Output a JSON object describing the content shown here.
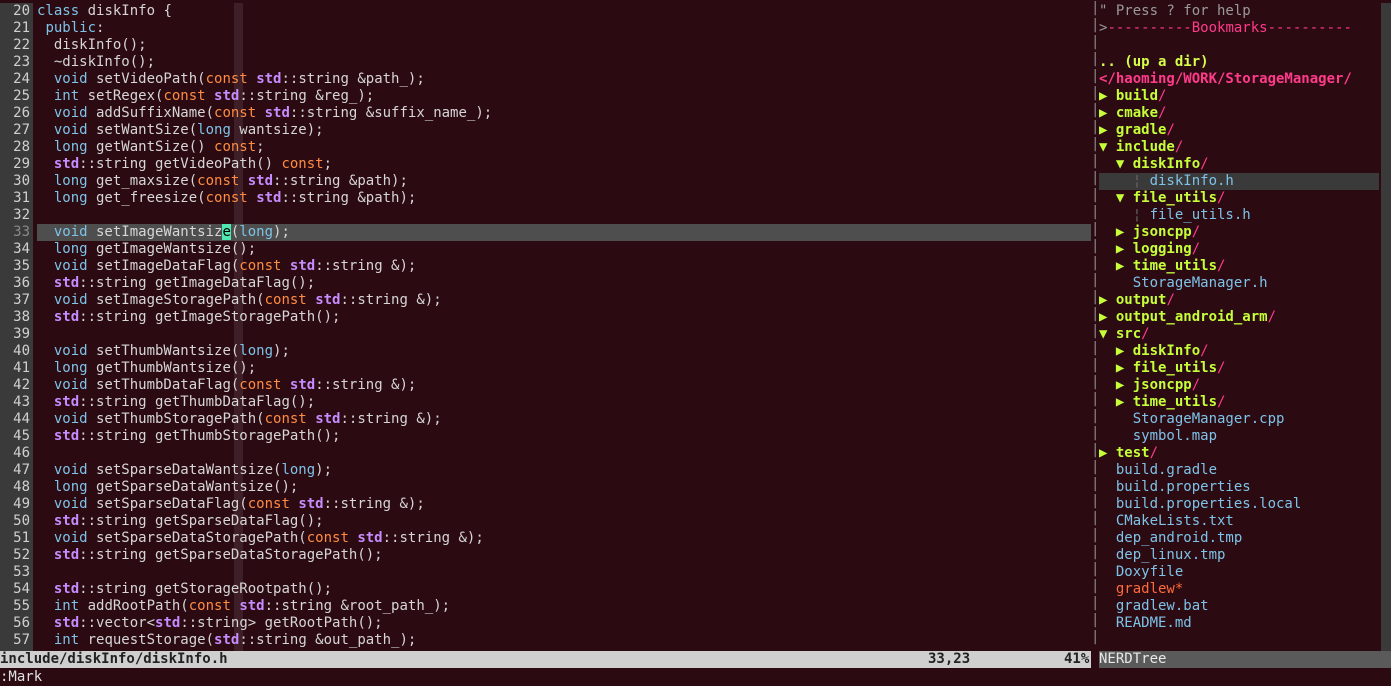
{
  "editor": {
    "lines": [
      {
        "n": "20",
        "code": [
          [
            "kw",
            "class"
          ],
          [
            "tx",
            " diskInfo {"
          ]
        ]
      },
      {
        "n": "21",
        "code": [
          [
            "tx",
            " "
          ],
          [
            "kw",
            "public"
          ],
          [
            "tx",
            ":"
          ]
        ]
      },
      {
        "n": "22",
        "code": [
          [
            "tx",
            "  diskInfo();"
          ]
        ]
      },
      {
        "n": "23",
        "code": [
          [
            "tx",
            "  ~diskInfo();"
          ]
        ]
      },
      {
        "n": "24",
        "code": [
          [
            "tx",
            "  "
          ],
          [
            "ty",
            "void"
          ],
          [
            "tx",
            " setVideoPath("
          ],
          [
            "cn",
            "const"
          ],
          [
            "tx",
            " "
          ],
          [
            "ns",
            "std"
          ],
          [
            "tx",
            "::string &path_);"
          ]
        ]
      },
      {
        "n": "25",
        "code": [
          [
            "tx",
            "  "
          ],
          [
            "ty",
            "int"
          ],
          [
            "tx",
            " setRegex("
          ],
          [
            "cn",
            "const"
          ],
          [
            "tx",
            " "
          ],
          [
            "ns",
            "std"
          ],
          [
            "tx",
            "::string &reg_);"
          ]
        ]
      },
      {
        "n": "26",
        "code": [
          [
            "tx",
            "  "
          ],
          [
            "ty",
            "void"
          ],
          [
            "tx",
            " addSuffixName("
          ],
          [
            "cn",
            "const"
          ],
          [
            "tx",
            " "
          ],
          [
            "ns",
            "std"
          ],
          [
            "tx",
            "::string &suffix_name_);"
          ]
        ]
      },
      {
        "n": "27",
        "code": [
          [
            "tx",
            "  "
          ],
          [
            "ty",
            "void"
          ],
          [
            "tx",
            " setWantSize("
          ],
          [
            "ty",
            "long"
          ],
          [
            "tx",
            " wantsize);"
          ]
        ]
      },
      {
        "n": "28",
        "code": [
          [
            "tx",
            "  "
          ],
          [
            "ty",
            "long"
          ],
          [
            "tx",
            " getWantSize() "
          ],
          [
            "cn",
            "const"
          ],
          [
            "tx",
            ";"
          ]
        ]
      },
      {
        "n": "29",
        "code": [
          [
            "tx",
            "  "
          ],
          [
            "ns",
            "std"
          ],
          [
            "tx",
            "::string getVideoPath() "
          ],
          [
            "cn",
            "const"
          ],
          [
            "tx",
            ";"
          ]
        ]
      },
      {
        "n": "30",
        "code": [
          [
            "tx",
            "  "
          ],
          [
            "ty",
            "long"
          ],
          [
            "tx",
            " get_maxsize("
          ],
          [
            "cn",
            "const"
          ],
          [
            "tx",
            " "
          ],
          [
            "ns",
            "std"
          ],
          [
            "tx",
            "::string &path);"
          ]
        ]
      },
      {
        "n": "31",
        "code": [
          [
            "tx",
            "  "
          ],
          [
            "ty",
            "long"
          ],
          [
            "tx",
            " get_freesize("
          ],
          [
            "cn",
            "const"
          ],
          [
            "tx",
            " "
          ],
          [
            "ns",
            "std"
          ],
          [
            "tx",
            "::string &path);"
          ]
        ]
      },
      {
        "n": "32",
        "code": []
      },
      {
        "n": "33",
        "cur": true,
        "code": [
          [
            "tx",
            "  "
          ],
          [
            "ty",
            "void"
          ],
          [
            "tx",
            " setImageWantsiz"
          ],
          [
            "cur",
            "e"
          ],
          [
            "tx",
            "("
          ],
          [
            "ty",
            "long"
          ],
          [
            "tx",
            ");"
          ]
        ]
      },
      {
        "n": "34",
        "code": [
          [
            "tx",
            "  "
          ],
          [
            "ty",
            "long"
          ],
          [
            "tx",
            " getImageWantsize();"
          ]
        ]
      },
      {
        "n": "35",
        "code": [
          [
            "tx",
            "  "
          ],
          [
            "ty",
            "void"
          ],
          [
            "tx",
            " setImageDataFlag("
          ],
          [
            "cn",
            "const"
          ],
          [
            "tx",
            " "
          ],
          [
            "ns",
            "std"
          ],
          [
            "tx",
            "::string &);"
          ]
        ]
      },
      {
        "n": "36",
        "code": [
          [
            "tx",
            "  "
          ],
          [
            "ns",
            "std"
          ],
          [
            "tx",
            "::string getImageDataFlag();"
          ]
        ]
      },
      {
        "n": "37",
        "code": [
          [
            "tx",
            "  "
          ],
          [
            "ty",
            "void"
          ],
          [
            "tx",
            " setImageStoragePath("
          ],
          [
            "cn",
            "const"
          ],
          [
            "tx",
            " "
          ],
          [
            "ns",
            "std"
          ],
          [
            "tx",
            "::string &);"
          ]
        ]
      },
      {
        "n": "38",
        "code": [
          [
            "tx",
            "  "
          ],
          [
            "ns",
            "std"
          ],
          [
            "tx",
            "::string getImageStoragePath();"
          ]
        ]
      },
      {
        "n": "39",
        "code": []
      },
      {
        "n": "40",
        "code": [
          [
            "tx",
            "  "
          ],
          [
            "ty",
            "void"
          ],
          [
            "tx",
            " setThumbWantsize("
          ],
          [
            "ty",
            "long"
          ],
          [
            "tx",
            ");"
          ]
        ]
      },
      {
        "n": "41",
        "code": [
          [
            "tx",
            "  "
          ],
          [
            "ty",
            "long"
          ],
          [
            "tx",
            " getThumbWantsize();"
          ]
        ]
      },
      {
        "n": "42",
        "code": [
          [
            "tx",
            "  "
          ],
          [
            "ty",
            "void"
          ],
          [
            "tx",
            " setThumbDataFlag("
          ],
          [
            "cn",
            "const"
          ],
          [
            "tx",
            " "
          ],
          [
            "ns",
            "std"
          ],
          [
            "tx",
            "::string &);"
          ]
        ]
      },
      {
        "n": "43",
        "code": [
          [
            "tx",
            "  "
          ],
          [
            "ns",
            "std"
          ],
          [
            "tx",
            "::string getThumbDataFlag();"
          ]
        ]
      },
      {
        "n": "44",
        "code": [
          [
            "tx",
            "  "
          ],
          [
            "ty",
            "void"
          ],
          [
            "tx",
            " setThumbStoragePath("
          ],
          [
            "cn",
            "const"
          ],
          [
            "tx",
            " "
          ],
          [
            "ns",
            "std"
          ],
          [
            "tx",
            "::string &);"
          ]
        ]
      },
      {
        "n": "45",
        "code": [
          [
            "tx",
            "  "
          ],
          [
            "ns",
            "std"
          ],
          [
            "tx",
            "::string getThumbStoragePath();"
          ]
        ]
      },
      {
        "n": "46",
        "code": []
      },
      {
        "n": "47",
        "code": [
          [
            "tx",
            "  "
          ],
          [
            "ty",
            "void"
          ],
          [
            "tx",
            " setSparseDataWantsize("
          ],
          [
            "ty",
            "long"
          ],
          [
            "tx",
            ");"
          ]
        ]
      },
      {
        "n": "48",
        "code": [
          [
            "tx",
            "  "
          ],
          [
            "ty",
            "long"
          ],
          [
            "tx",
            " getSparseDataWantsize();"
          ]
        ]
      },
      {
        "n": "49",
        "code": [
          [
            "tx",
            "  "
          ],
          [
            "ty",
            "void"
          ],
          [
            "tx",
            " setSparseDataFlag("
          ],
          [
            "cn",
            "const"
          ],
          [
            "tx",
            " "
          ],
          [
            "ns",
            "std"
          ],
          [
            "tx",
            "::string &);"
          ]
        ]
      },
      {
        "n": "50",
        "code": [
          [
            "tx",
            "  "
          ],
          [
            "ns",
            "std"
          ],
          [
            "tx",
            "::string getSparseDataFlag();"
          ]
        ]
      },
      {
        "n": "51",
        "code": [
          [
            "tx",
            "  "
          ],
          [
            "ty",
            "void"
          ],
          [
            "tx",
            " setSparseDataStoragePath("
          ],
          [
            "cn",
            "const"
          ],
          [
            "tx",
            " "
          ],
          [
            "ns",
            "std"
          ],
          [
            "tx",
            "::string &);"
          ]
        ]
      },
      {
        "n": "52",
        "code": [
          [
            "tx",
            "  "
          ],
          [
            "ns",
            "std"
          ],
          [
            "tx",
            "::string getSparseDataStoragePath();"
          ]
        ]
      },
      {
        "n": "53",
        "code": []
      },
      {
        "n": "54",
        "code": [
          [
            "tx",
            "  "
          ],
          [
            "ns",
            "std"
          ],
          [
            "tx",
            "::string getStorageRootpath();"
          ]
        ]
      },
      {
        "n": "55",
        "code": [
          [
            "tx",
            "  "
          ],
          [
            "ty",
            "int"
          ],
          [
            "tx",
            " addRootPath("
          ],
          [
            "cn",
            "const"
          ],
          [
            "tx",
            " "
          ],
          [
            "ns",
            "std"
          ],
          [
            "tx",
            "::string &root_path_);"
          ]
        ]
      },
      {
        "n": "56",
        "code": [
          [
            "tx",
            "  "
          ],
          [
            "ns",
            "std"
          ],
          [
            "tx",
            "::vector<"
          ],
          [
            "ns",
            "std"
          ],
          [
            "tx",
            "::string> getRootPath();"
          ]
        ]
      },
      {
        "n": "57",
        "code": [
          [
            "tx",
            "  "
          ],
          [
            "ty",
            "int"
          ],
          [
            "tx",
            " requestStorage("
          ],
          [
            "ns",
            "std"
          ],
          [
            "tx",
            "::string &out_path_);"
          ]
        ]
      }
    ]
  },
  "tree": {
    "help": "\" Press ? for help",
    "bookmarks_prefix": ">",
    "bookmarks": "----------Bookmarks----------",
    "up_dir": ".. (up a dir)",
    "root": "</haoming/WORK/StorageManager/",
    "entries": [
      {
        "indent": "",
        "arrow": "▶ ",
        "name": "build",
        "kind": "dir"
      },
      {
        "indent": "",
        "arrow": "▶ ",
        "name": "cmake",
        "kind": "dir"
      },
      {
        "indent": "",
        "arrow": "▶ ",
        "name": "gradle",
        "kind": "dir"
      },
      {
        "indent": "",
        "arrow": "▼ ",
        "name": "include",
        "kind": "dir"
      },
      {
        "indent": "  ",
        "arrow": "▼ ",
        "name": "diskInfo",
        "kind": "dir"
      },
      {
        "indent": "    ",
        "arrow": "¦ ",
        "name": "diskInfo.h",
        "kind": "file",
        "sel": true
      },
      {
        "indent": "  ",
        "arrow": "▼ ",
        "name": "file_utils",
        "kind": "dir"
      },
      {
        "indent": "    ",
        "arrow": "¦ ",
        "name": "file_utils.h",
        "kind": "file"
      },
      {
        "indent": "  ",
        "arrow": "▶ ",
        "name": "jsoncpp",
        "kind": "dir"
      },
      {
        "indent": "  ",
        "arrow": "▶ ",
        "name": "logging",
        "kind": "dir"
      },
      {
        "indent": "  ",
        "arrow": "▶ ",
        "name": "time_utils",
        "kind": "dir"
      },
      {
        "indent": "  ",
        "arrow": "  ",
        "name": "StorageManager.h",
        "kind": "file"
      },
      {
        "indent": "",
        "arrow": "▶ ",
        "name": "output",
        "kind": "dir"
      },
      {
        "indent": "",
        "arrow": "▶ ",
        "name": "output_android_arm",
        "kind": "dir"
      },
      {
        "indent": "",
        "arrow": "▼ ",
        "name": "src",
        "kind": "dir"
      },
      {
        "indent": "  ",
        "arrow": "▶ ",
        "name": "diskInfo",
        "kind": "dir"
      },
      {
        "indent": "  ",
        "arrow": "▶ ",
        "name": "file_utils",
        "kind": "dir"
      },
      {
        "indent": "  ",
        "arrow": "▶ ",
        "name": "jsoncpp",
        "kind": "dir"
      },
      {
        "indent": "  ",
        "arrow": "▶ ",
        "name": "time_utils",
        "kind": "dir"
      },
      {
        "indent": "  ",
        "arrow": "  ",
        "name": "StorageManager.cpp",
        "kind": "file"
      },
      {
        "indent": "  ",
        "arrow": "  ",
        "name": "symbol.map",
        "kind": "file"
      },
      {
        "indent": "",
        "arrow": "▶ ",
        "name": "test",
        "kind": "dir"
      },
      {
        "indent": "",
        "arrow": "  ",
        "name": "build.gradle",
        "kind": "file"
      },
      {
        "indent": "",
        "arrow": "  ",
        "name": "build.properties",
        "kind": "file"
      },
      {
        "indent": "",
        "arrow": "  ",
        "name": "build.properties.local",
        "kind": "file"
      },
      {
        "indent": "",
        "arrow": "  ",
        "name": "CMakeLists.txt",
        "kind": "file"
      },
      {
        "indent": "",
        "arrow": "  ",
        "name": "dep_android.tmp",
        "kind": "file"
      },
      {
        "indent": "",
        "arrow": "  ",
        "name": "dep_linux.tmp",
        "kind": "file"
      },
      {
        "indent": "",
        "arrow": "  ",
        "name": "Doxyfile",
        "kind": "file"
      },
      {
        "indent": "",
        "arrow": "  ",
        "name": "gradlew*",
        "kind": "exec"
      },
      {
        "indent": "",
        "arrow": "  ",
        "name": "gradlew.bat",
        "kind": "file"
      },
      {
        "indent": "",
        "arrow": "  ",
        "name": "README.md",
        "kind": "file"
      }
    ]
  },
  "status": {
    "file": "include/diskInfo/diskInfo.h",
    "position": "33,23",
    "percent": "41%",
    "tree_label": "NERDTree"
  },
  "cmdline": ":Mark",
  "colors": {
    "background": "#2b0a12",
    "keyword": "#7ec3e8",
    "namespace": "#c78cff",
    "const": "#ff8c42",
    "dir": "#c6ff3a",
    "bookmark": "#ff3b8a"
  }
}
